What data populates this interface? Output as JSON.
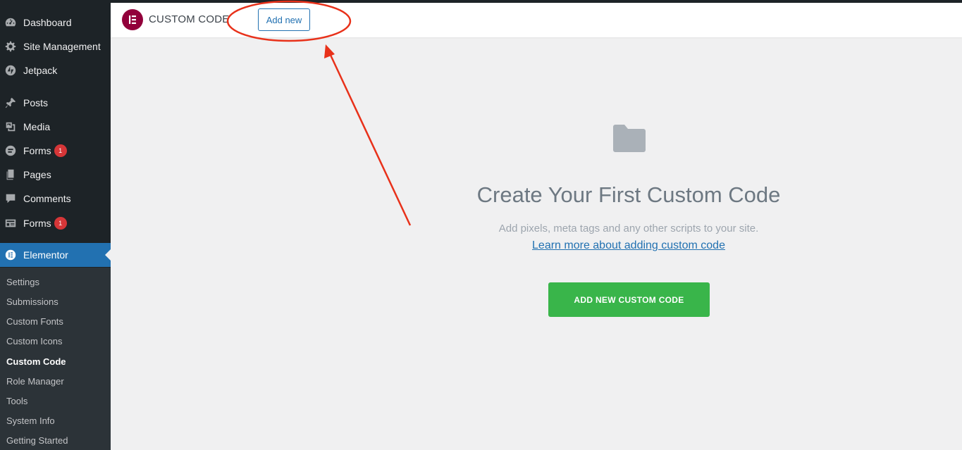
{
  "sidebar": {
    "items": [
      {
        "label": "Dashboard",
        "icon": "dashboard-icon"
      },
      {
        "label": "Site Management",
        "icon": "gear-icon"
      },
      {
        "label": "Jetpack",
        "icon": "jetpack-icon"
      },
      {
        "label": "Posts",
        "icon": "pushpin-icon"
      },
      {
        "label": "Media",
        "icon": "media-icon"
      },
      {
        "label": "Forms",
        "icon": "forms-icon",
        "badge": "1"
      },
      {
        "label": "Pages",
        "icon": "pages-icon"
      },
      {
        "label": "Comments",
        "icon": "comment-icon"
      },
      {
        "label": "Forms",
        "icon": "feedback-icon",
        "badge": "1"
      },
      {
        "label": "Elementor",
        "icon": "elementor-icon",
        "active": true
      }
    ],
    "submenu": [
      "Settings",
      "Submissions",
      "Custom Fonts",
      "Custom Icons",
      "Custom Code",
      "Role Manager",
      "Tools",
      "System Info",
      "Getting Started"
    ],
    "current_submenu": "Custom Code"
  },
  "header": {
    "title": "CUSTOM CODE",
    "add_new_label": "Add new"
  },
  "empty_state": {
    "icon": "folder-icon",
    "title": "Create Your First Custom Code",
    "description": "Add pixels, meta tags and any other scripts to your site.",
    "link_text": "Learn more about adding custom code",
    "cta_label": "ADD NEW CUSTOM CODE"
  },
  "colors": {
    "sidebar_bg": "#1d2327",
    "submenu_bg": "#2c3338",
    "active_blue": "#2271b1",
    "badge_red": "#d63638",
    "elementor_brand": "#92003b",
    "cta_green": "#39b54a",
    "annotation_red": "#e8311a"
  }
}
